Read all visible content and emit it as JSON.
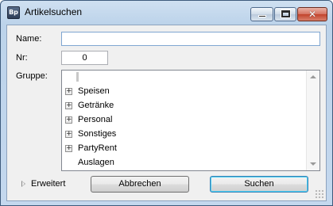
{
  "window": {
    "title": "Artikelsuchen",
    "app_icon_text": "Bp",
    "controls": {
      "minimize": "minimize-icon",
      "maximize": "maximize-icon",
      "close": "close-icon",
      "close_glyph": "✕"
    }
  },
  "form": {
    "name_label": "Name:",
    "name_value": "",
    "nr_label": "Nr:",
    "nr_value": "0",
    "gruppe_label": "Gruppe:"
  },
  "tree": {
    "items": [
      {
        "label": "Speisen",
        "expandable": true
      },
      {
        "label": "Getränke",
        "expandable": true
      },
      {
        "label": "Personal",
        "expandable": true
      },
      {
        "label": "Sonstiges",
        "expandable": true
      },
      {
        "label": "PartyRent",
        "expandable": true
      },
      {
        "label": "Auslagen",
        "expandable": false
      }
    ],
    "expander_glyph": "+"
  },
  "footer": {
    "erweitert_label": "Erweitert",
    "cancel_label": "Abbrechen",
    "search_label": "Suchen"
  },
  "colors": {
    "title_bar": "#c4d8ee",
    "client_bg": "#f0f0f0",
    "close_button": "#c2432c",
    "focus_border": "#7fa6d1"
  }
}
